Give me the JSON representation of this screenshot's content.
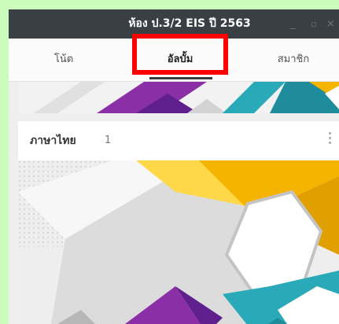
{
  "window": {
    "title": "ห้อง ป.3/2 EIS ปี 2563",
    "minimize": "_",
    "maximize": "▫",
    "close": "×"
  },
  "tabs": [
    {
      "label": "โน้ต"
    },
    {
      "label": "อัลบั้ม",
      "selected": true
    },
    {
      "label": "สมาชิก"
    }
  ],
  "album": {
    "name": "ภาษาไทย",
    "count": "1"
  },
  "colors": {
    "titlebar": "#3a3e45",
    "highlight": "#ff0000",
    "background": "#ccfcbc"
  }
}
